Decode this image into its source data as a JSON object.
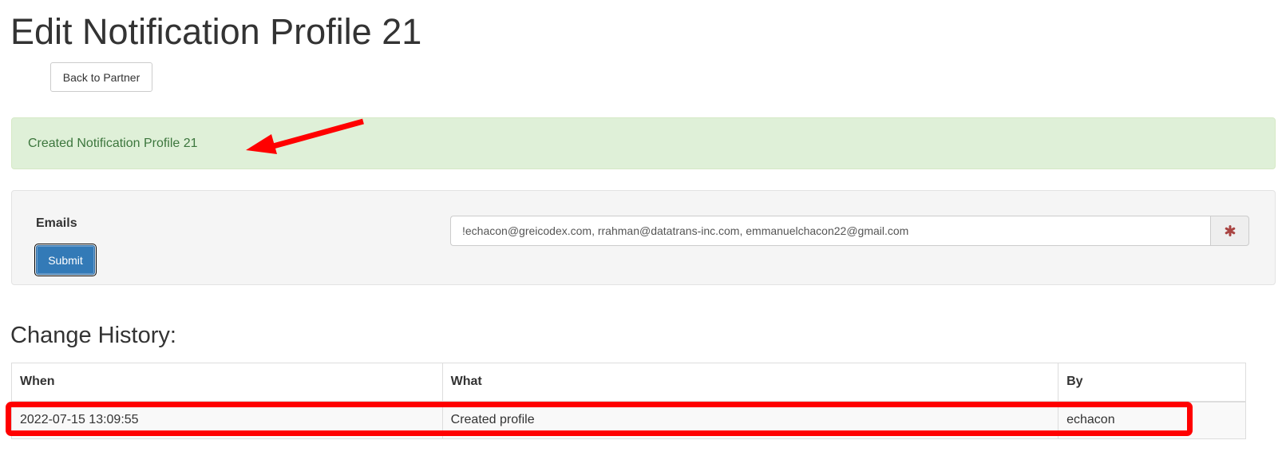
{
  "page": {
    "title": "Edit Notification Profile 21",
    "back_label": "Back to Partner"
  },
  "alert": {
    "message": "Created Notification Profile 21"
  },
  "form": {
    "emails_label": "Emails",
    "emails_value": "!echacon@greicodex.com, rrahman@datatrans-inc.com, emmanuelchacon22@gmail.com",
    "required_icon": "asterisk-icon",
    "submit_label": "Submit"
  },
  "history": {
    "title": "Change History:",
    "columns": [
      "When",
      "What",
      "By"
    ],
    "rows": [
      [
        "2022-07-15 13:09:55",
        "Created profile",
        "echacon"
      ]
    ]
  },
  "annotations": {
    "color": "#ff0000"
  },
  "colors": {
    "primary": "#337ab7",
    "success_bg": "#dff0d8",
    "success_text": "#3c763d"
  }
}
